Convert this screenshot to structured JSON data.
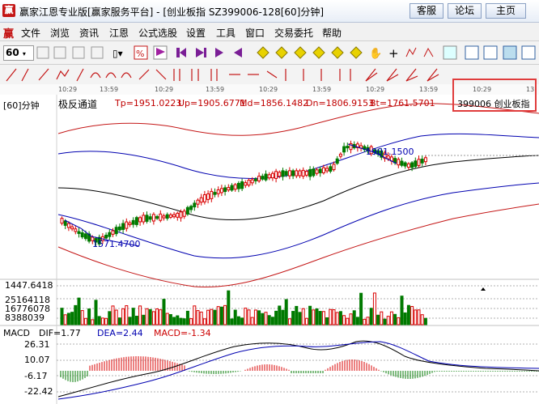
{
  "window": {
    "title": "赢家江恩专业版[赢家服务平台] - [创业板指  SZ399006-128[60]分钟]",
    "buttons": [
      "客服",
      "论坛",
      "主页"
    ]
  },
  "menu": {
    "items": [
      "文件",
      "浏览",
      "资讯",
      "江恩",
      "公式选股",
      "设置",
      "工具",
      "窗口",
      "交易委托",
      "帮助"
    ]
  },
  "toolbar": {
    "period": "60"
  },
  "ruler": {
    "times": [
      "10:29",
      "13:59",
      "10:29",
      "13:59",
      "10:29",
      "13:59",
      "10:29",
      "13:59",
      "10:29",
      "13"
    ]
  },
  "chart": {
    "period_label": "[60]分钟",
    "indicator_name": "极反通道",
    "values": {
      "tp": "Tp=1951.0223",
      "up": "Up=1905.6771",
      "md": "Md=1856.1482",
      "dn": "Dn=1806.9153",
      "bt": "Bt=1761.5701"
    },
    "stock_tag": "399006 创业板指",
    "annot_high": "1901.1500",
    "annot_low": "1571.4700",
    "price_label": "1447.6418",
    "vol_labels": [
      "25164118",
      "16776078",
      "8388039"
    ],
    "colors": {
      "up": "#d90000",
      "down": "#007a00",
      "channel_outer": "#c41616",
      "channel_mid": "#0000b0",
      "channel_center": "#000000"
    }
  },
  "macd": {
    "name": "MACD",
    "dif": "DIF=1.77",
    "dea": "DEA=2.44",
    "macd": "MACD=-1.34",
    "ylabels": [
      "26.31",
      "10.07",
      "-6.17",
      "-22.42"
    ]
  }
}
